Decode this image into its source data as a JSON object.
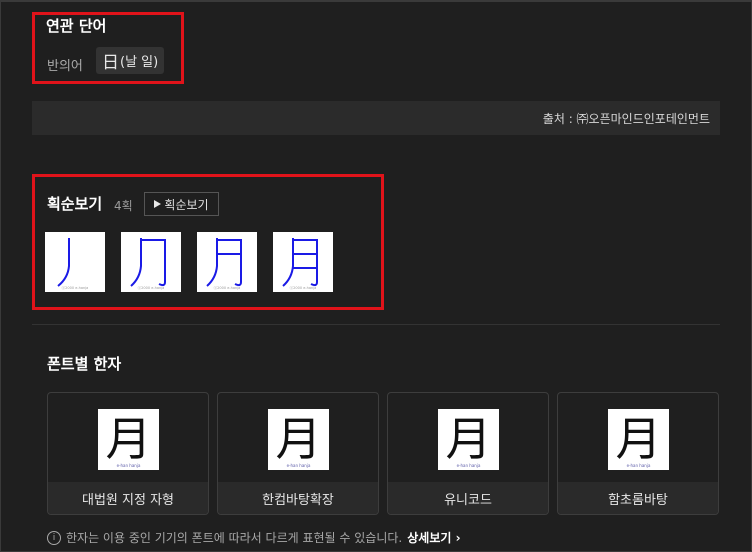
{
  "related": {
    "title": "연관 단어",
    "antonym_label": "반의어",
    "antonym_hanja": "日",
    "antonym_meaning": "(날 일)"
  },
  "source": {
    "text": "출처 : ㈜오픈마인드인포테인먼트"
  },
  "stroke_order": {
    "title": "획순보기",
    "count": "4획",
    "button_label": "획순보기",
    "watermark": "ⓒ2000 e-hanja"
  },
  "fonts": {
    "title": "폰트별 한자",
    "character": "月",
    "card_watermark": "e-han hanja",
    "cards": [
      {
        "name": "대법원 지정 자형"
      },
      {
        "name": "한컴바탕확장"
      },
      {
        "name": "유니코드"
      },
      {
        "name": "함초롬바탕"
      }
    ]
  },
  "notice": {
    "text": "한자는 이용 중인 기기의 폰트에 따라서 다르게 표현될 수 있습니다.",
    "link": "상세보기 ›"
  },
  "colors": {
    "highlight": "#e0131a",
    "stroke": "#1a1ae6",
    "background": "#1f1f1f"
  }
}
